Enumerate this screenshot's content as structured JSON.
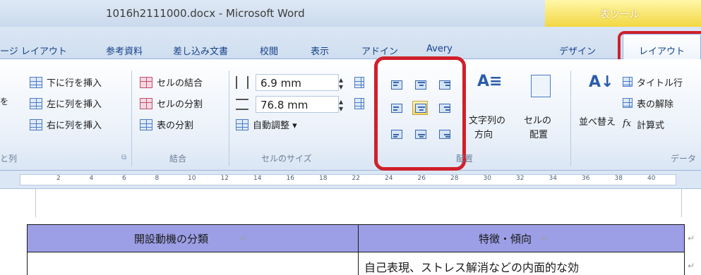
{
  "window": {
    "title": "1016h2111000.docx - Microsoft Word",
    "context_tool_label": "表ツール"
  },
  "tabs": [
    {
      "label": "ージ レイアウト"
    },
    {
      "label": "参考資料"
    },
    {
      "label": "差し込み文書"
    },
    {
      "label": "校閲"
    },
    {
      "label": "表示"
    },
    {
      "label": "アドイン"
    },
    {
      "label": "Avery"
    },
    {
      "label": "デザイン"
    },
    {
      "label": "レイアウト"
    }
  ],
  "ribbon": {
    "rows_cols": {
      "insert_below": "下に行を挿入",
      "insert_left": "左に列を挿入",
      "insert_right": "右に列を挿入",
      "partial_left_1": "を",
      "group_label": "と列"
    },
    "merge": {
      "merge_cells": "セルの結合",
      "split_cells": "セルの分割",
      "split_table": "表の分割",
      "group_label": "結合"
    },
    "cell_size": {
      "height_value": "6.9 mm",
      "width_value": "76.8 mm",
      "autofit": "自動調整 ▾",
      "group_label": "セルのサイズ"
    },
    "alignment": {
      "text_direction_line1": "文字列の",
      "text_direction_line2": "方向",
      "cell_margins_line1": "セルの",
      "cell_margins_line2": "配置",
      "group_label": "配置"
    },
    "data": {
      "sort": "並べ替え",
      "repeat_header": "タイトル行",
      "convert_to_text": "表の解除",
      "formula": "計算式",
      "group_label": "データ"
    }
  },
  "ruler": {
    "numbers": [
      "2",
      "4",
      "6",
      "8",
      "10",
      "12",
      "14",
      "16",
      "18",
      "22",
      "24",
      "26",
      "28",
      "30",
      "32",
      "34",
      "36",
      "38",
      "40"
    ]
  },
  "document": {
    "header_col1": "開設動機の分類",
    "header_col2": "特徴・傾向",
    "row1_col2": "自己表現、ストレス解消などの内面的な効",
    "pilcrow": "↵"
  },
  "colors": {
    "highlight_red": "#d0202a",
    "table_header_bg": "#9c9ee6",
    "ribbon_text": "#15428b"
  }
}
